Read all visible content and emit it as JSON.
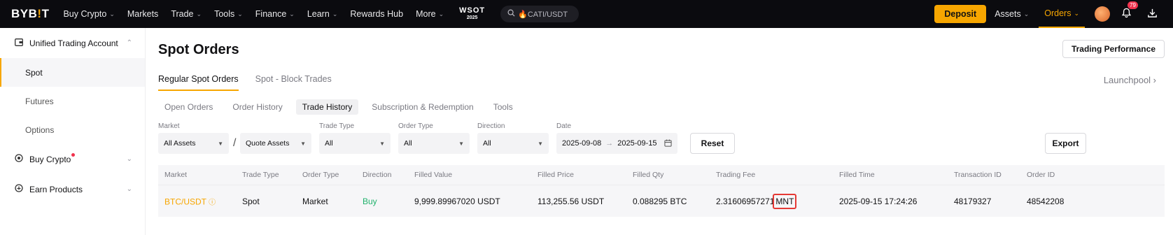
{
  "topbar": {
    "logo_left": "BYB",
    "logo_bar": "!",
    "logo_right": "T",
    "nav": [
      {
        "label": "Buy Crypto",
        "chevron": true
      },
      {
        "label": "Markets",
        "chevron": false
      },
      {
        "label": "Trade",
        "chevron": true
      },
      {
        "label": "Tools",
        "chevron": true
      },
      {
        "label": "Finance",
        "chevron": true
      },
      {
        "label": "Learn",
        "chevron": true
      },
      {
        "label": "Rewards Hub",
        "chevron": false
      },
      {
        "label": "More",
        "chevron": true
      }
    ],
    "wsot_title": "WSOT",
    "wsot_year": "2025",
    "search_text": "🔥CATI/USDT",
    "deposit_label": "Deposit",
    "assets_label": "Assets",
    "orders_label": "Orders",
    "notification_count": "79",
    "accent_color": "#f7a600"
  },
  "sidebar": {
    "account_label": "Unified Trading Account",
    "sub_items": [
      "Spot",
      "Futures",
      "Options"
    ],
    "active_sub": "Spot",
    "buy_crypto_label": "Buy Crypto",
    "earn_label": "Earn Products"
  },
  "main": {
    "title": "Spot Orders",
    "trading_performance_label": "Trading Performance",
    "tabs": [
      "Regular Spot Orders",
      "Spot - Block Trades"
    ],
    "launchpool_label": "Launchpool ›",
    "subtabs": [
      "Open Orders",
      "Order History",
      "Trade History",
      "Subscription & Redemption",
      "Tools"
    ],
    "active_subtab": "Trade History",
    "filters": {
      "market_label": "Market",
      "base_value": "All Assets",
      "quote_value": "Quote Assets",
      "trade_type_label": "Trade Type",
      "trade_type_value": "All",
      "order_type_label": "Order Type",
      "order_type_value": "All",
      "direction_label": "Direction",
      "direction_value": "All",
      "date_label": "Date",
      "date_from": "2025-09-08",
      "date_arrow": "→",
      "date_to": "2025-09-15",
      "reset_label": "Reset",
      "export_label": "Export"
    },
    "table": {
      "headers": [
        "Market",
        "Trade Type",
        "Order Type",
        "Direction",
        "Filled Value",
        "Filled Price",
        "Filled Qty",
        "Trading Fee",
        "Filled Time",
        "Transaction ID",
        "Order ID"
      ],
      "rows": [
        {
          "market": "BTC/USDT",
          "trade_type": "Spot",
          "order_type": "Market",
          "direction": "Buy",
          "filled_value": "9,999.89967020 USDT",
          "filled_price": "113,255.56 USDT",
          "filled_qty": "0.088295 BTC",
          "fee_amount": "2.31606957271",
          "fee_currency": "MNT",
          "filled_time": "2025-09-15 17:24:26",
          "transaction_id": "48179327",
          "order_id": "48542208"
        }
      ]
    }
  }
}
